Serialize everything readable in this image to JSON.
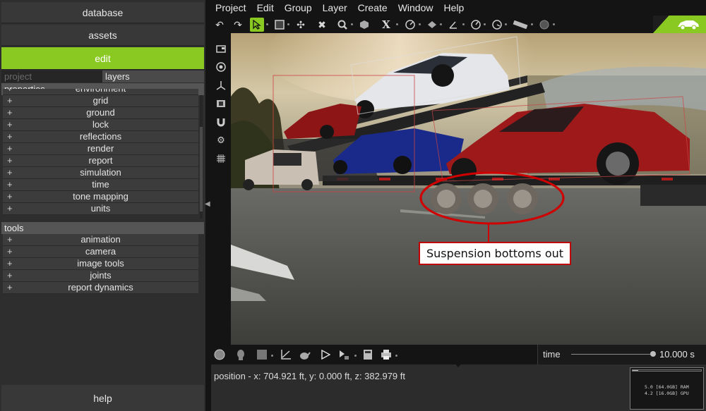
{
  "left_panel": {
    "buttons": {
      "database": "database",
      "assets": "assets",
      "edit": "edit"
    },
    "tabs": {
      "project": "project",
      "layers": "layers"
    },
    "properties": {
      "header": "properties",
      "items": [
        "environment",
        "grid",
        "ground",
        "lock",
        "reflections",
        "render",
        "report",
        "simulation",
        "time",
        "tone mapping",
        "units"
      ]
    },
    "tools": {
      "header": "tools",
      "items": [
        "animation",
        "camera",
        "image tools",
        "joints",
        "report dynamics"
      ]
    },
    "plus": "+",
    "help": "help"
  },
  "menu": {
    "items": [
      "Project",
      "Edit",
      "Group",
      "Layer",
      "Create",
      "Window",
      "Help"
    ]
  },
  "toolbar": {
    "icons": [
      "undo-icon",
      "redo-icon",
      "select-arrow-icon",
      "box-select-icon",
      "pin-icon",
      "delete-x-icon",
      "zoom-icon",
      "cube-icon",
      "x-axis-icon",
      "measure-icon",
      "plane-icon",
      "angle-icon",
      "gauge-icon",
      "ruler-icon",
      "record-icon"
    ],
    "x_glyph": "X"
  },
  "viewport": {
    "annotation": "Suspension bottoms out"
  },
  "timeline": {
    "label": "time",
    "value": "10.000 s"
  },
  "status": {
    "position": "position - x: 704.921 ft, y: 0.000 ft, z: 382.979 ft",
    "mem_ram": "5.0 [64.0GB] RAM",
    "mem_gpu": "4.2 [16.0GB] GPU"
  },
  "colors": {
    "accent": "#8ac922",
    "callout_border": "#c00000"
  }
}
